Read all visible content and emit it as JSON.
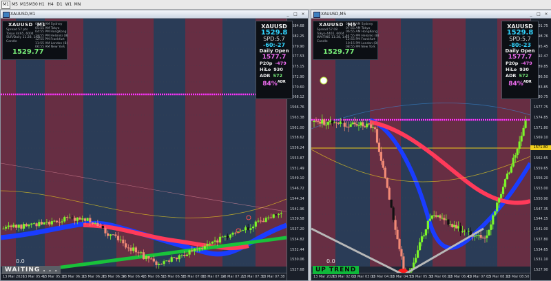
{
  "timeframes": [
    "M1",
    "M5",
    "M15",
    "M30",
    "H1",
    "H4",
    "D1",
    "W1",
    "MN"
  ],
  "active_timeframe": "M1",
  "colors": {
    "bull": "#7cf52a",
    "bear": "#f28a76",
    "magenta": "#ff33ff",
    "grid": "#263042",
    "red_band": "#6b2e45",
    "blue_band": "#2b3d5a",
    "up_band": "#1a3cff",
    "down_band": "#ff3a5a",
    "gold": "#f0d01e",
    "cyan": "#33d6ff"
  },
  "left": {
    "window_title": "XAUUSD,M1",
    "symbol": "XAUUSD",
    "tf_label": "M1",
    "info_rows": [
      [
        "Spread",
        "57 pts"
      ],
      [
        "Tokyo",
        "4465, 6004"
      ],
      [
        "SUR/Daily",
        "11:28, 1:61"
      ],
      [
        "Candle",
        ""
      ]
    ],
    "sessions": [
      [
        "08:55 AM",
        "Sydney"
      ],
      [
        "05:55 AM",
        "Tokyo"
      ],
      [
        "04:55 PM",
        "HongKong"
      ],
      [
        "11:55 PM",
        "Helsinki (B)"
      ],
      [
        "12:55 PM",
        "Frankfurt"
      ],
      [
        "11:55 AM",
        "London (B)"
      ],
      [
        "06:55 AM",
        "New York"
      ]
    ],
    "last_price": "1529.77",
    "panel": {
      "symbol": "XAUUSD",
      "price": "1529.8",
      "spread": "SPD:5.7",
      "timer": "-60:-27",
      "daily_open_label": "Daily Open",
      "daily_open": "1577.7",
      "p20_label": "P20p",
      "p20": "-479",
      "hilo_label": "HiLo",
      "hilo": "930",
      "adr_label": "ADR",
      "adr": "572",
      "pct": "84%",
      "pct_label": "ADR"
    },
    "status_zero": "0.0",
    "status_text": "WAITING . . .",
    "y_labels": [
      "1584.68",
      "1582.25",
      "1579.90",
      "1577.53",
      "1575.15",
      "1572.90",
      "1570.60",
      "1568.12",
      "1566.76",
      "1563.38",
      "1561.00",
      "1558.62",
      "1556.24",
      "1553.87",
      "1551.49",
      "1549.10",
      "1546.72",
      "1544.34",
      "1541.96",
      "1539.58",
      "1537.20",
      "1534.82",
      "1532.44",
      "1530.06",
      "1527.68"
    ],
    "x_labels": [
      "13 Mar 2020",
      "13 Mar 05:42",
      "13 Mar 05:18",
      "13 Mar 06:10",
      "13 Mar 06:26",
      "13 Mar 06:34",
      "13 Mar 06:42",
      "13 Mar 06:50",
      "13 Mar 06:58",
      "13 Mar 07:06",
      "13 Mar 07:14",
      "13 Mar 07:22",
      "13 Mar 07:30",
      "13 Mar 07:38"
    ]
  },
  "right": {
    "window_title": "XAUUSD,M5",
    "symbol": "XAUUSD",
    "tf_label": "M5",
    "info_rows": [
      [
        "Spread",
        "57.08"
      ],
      [
        "Tokyo",
        "4465, 6004"
      ],
      [
        "WAITING",
        "11:28, 1:61"
      ],
      [
        "Candle",
        ""
      ]
    ],
    "sessions": [
      [
        "08:15 AM",
        "Sydney"
      ],
      [
        "07:55 AM",
        "Tokyo"
      ],
      [
        "06:55 AM",
        "HongKong"
      ],
      [
        "11:55 PM",
        "Helsinki (B)"
      ],
      [
        "12:55 PM",
        "Frankfurt"
      ],
      [
        "10:15 PM",
        "London (B)"
      ],
      [
        "08:55 PM",
        "New York"
      ]
    ],
    "last_price": "1529.77",
    "panel": {
      "symbol": "XAUUSD",
      "price": "1529.8",
      "spread": "SPD:5.7",
      "timer": "-80:-23",
      "daily_open_label": "Daily Open",
      "daily_open": "1577.7",
      "p20_label": "P20p",
      "p20": "-479",
      "hilo_label": "HiLo",
      "hilo": "930",
      "adr_label": "ADR",
      "adr": "572",
      "pct": "84%",
      "pct_label": "ADR"
    },
    "status_zero": "0.0",
    "status_text": "UP TREND",
    "price_tag": "1571.80",
    "y_labels": [
      "1601.75",
      "1598.76",
      "1595.45",
      "1592.47",
      "1589.85",
      "1586.50",
      "1583.85",
      "1580.75",
      "1577.75",
      "1574.85",
      "1571.80",
      "1569.10",
      "1565.80",
      "1562.65",
      "1559.65",
      "1556.20",
      "1553.00",
      "1550.90",
      "1547.35",
      "1544.15",
      "1541.00",
      "1537.80",
      "1534.65",
      "1531.10",
      "1527.90"
    ],
    "x_labels": [
      "13 Mar 2020",
      "13 Mar 02:00",
      "13 Mar 03:00",
      "13 Mar 04:10",
      "13 Mar 04:55",
      "13 Mar 05:30",
      "13 Mar 06:10",
      "13 Mar 06:45",
      "13 Mar 07:05",
      "13 Mar 08:10",
      "13 Mar 08:50"
    ]
  }
}
